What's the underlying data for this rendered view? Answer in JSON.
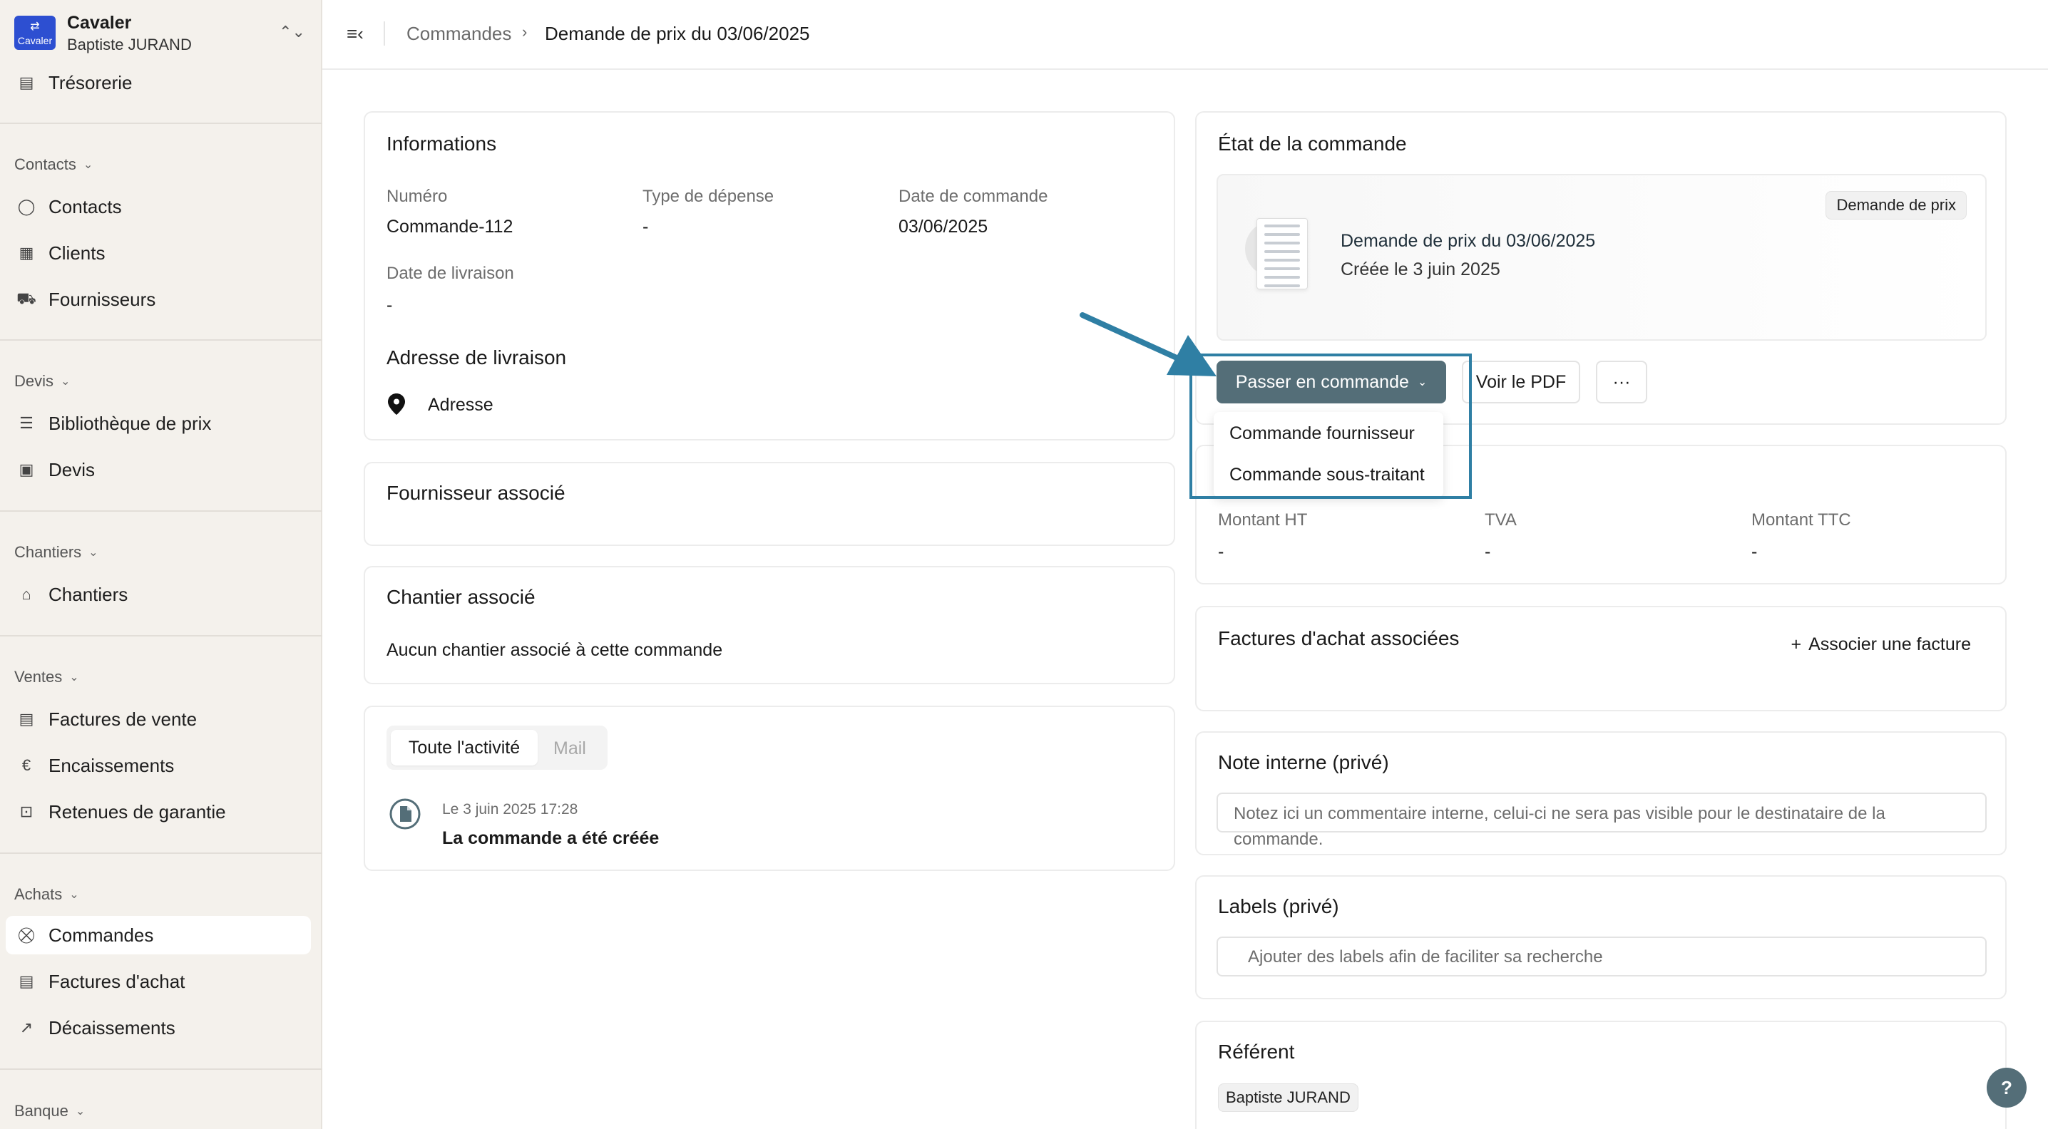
{
  "brand": {
    "logo_text": "Cavaler",
    "name": "Cavaler",
    "user": "Baptiste JURAND"
  },
  "sidebar": {
    "top_item": "Trésorerie",
    "sections": {
      "contacts": "Contacts",
      "devis": "Devis",
      "chantiers": "Chantiers",
      "ventes": "Ventes",
      "achats": "Achats",
      "banque": "Banque"
    },
    "items": {
      "contacts": "Contacts",
      "clients": "Clients",
      "fournisseurs": "Fournisseurs",
      "bibliotheque": "Bibliothèque de prix",
      "devis": "Devis",
      "chantiers": "Chantiers",
      "factures_vente": "Factures de vente",
      "encaissements": "Encaissements",
      "retenues": "Retenues de garantie",
      "commandes": "Commandes",
      "factures_achat": "Factures d'achat",
      "decaissements": "Décaissements"
    }
  },
  "breadcrumb": {
    "parent": "Commandes",
    "separator": "›",
    "current": "Demande de prix du 03/06/2025"
  },
  "informations": {
    "title": "Informations",
    "numero_label": "Numéro",
    "numero_value": "Commande-112",
    "type_label": "Type de dépense",
    "type_value": "-",
    "date_cmd_label": "Date de commande",
    "date_cmd_value": "03/06/2025",
    "date_liv_label": "Date de livraison",
    "date_liv_value": "-",
    "adresse_title": "Adresse de livraison",
    "adresse_value": "Adresse"
  },
  "fournisseur": {
    "title": "Fournisseur associé"
  },
  "chantier": {
    "title": "Chantier associé",
    "empty": "Aucun chantier associé à cette commande"
  },
  "activity": {
    "tab_all": "Toute l'activité",
    "tab_mail": "Mail",
    "entry_time": "Le 3 juin 2025 17:28",
    "entry_text": "La commande a été créée"
  },
  "etat": {
    "title": "État de la commande",
    "badge": "Demande de prix",
    "doc_title": "Demande de prix du 03/06/2025",
    "doc_sub": "Créée le 3 juin 2025",
    "primary_button": "Passer en commande",
    "pdf_button": "Voir le PDF",
    "more_button": "···",
    "dropdown": [
      "Commande fournisseur",
      "Commande sous-traitant"
    ]
  },
  "montants": {
    "ht_label": "Montant HT",
    "ht_value": "-",
    "tva_label": "TVA",
    "tva_value": "-",
    "ttc_label": "Montant TTC",
    "ttc_value": "-"
  },
  "factures": {
    "title": "Factures d'achat associées",
    "action": "Associer une facture"
  },
  "note": {
    "title": "Note interne (privé)",
    "placeholder": "Notez ici un commentaire interne, celui-ci ne sera pas visible pour le destinataire de la commande."
  },
  "labels": {
    "title": "Labels (privé)",
    "placeholder": "Ajouter des labels afin de faciliter sa recherche"
  },
  "referent": {
    "title": "Référent",
    "name": "Baptiste JURAND"
  },
  "help": "?",
  "colors": {
    "primary_button": "#546e78",
    "highlight": "#2f7fa4",
    "sidebar_bg": "#f4f1ec"
  }
}
